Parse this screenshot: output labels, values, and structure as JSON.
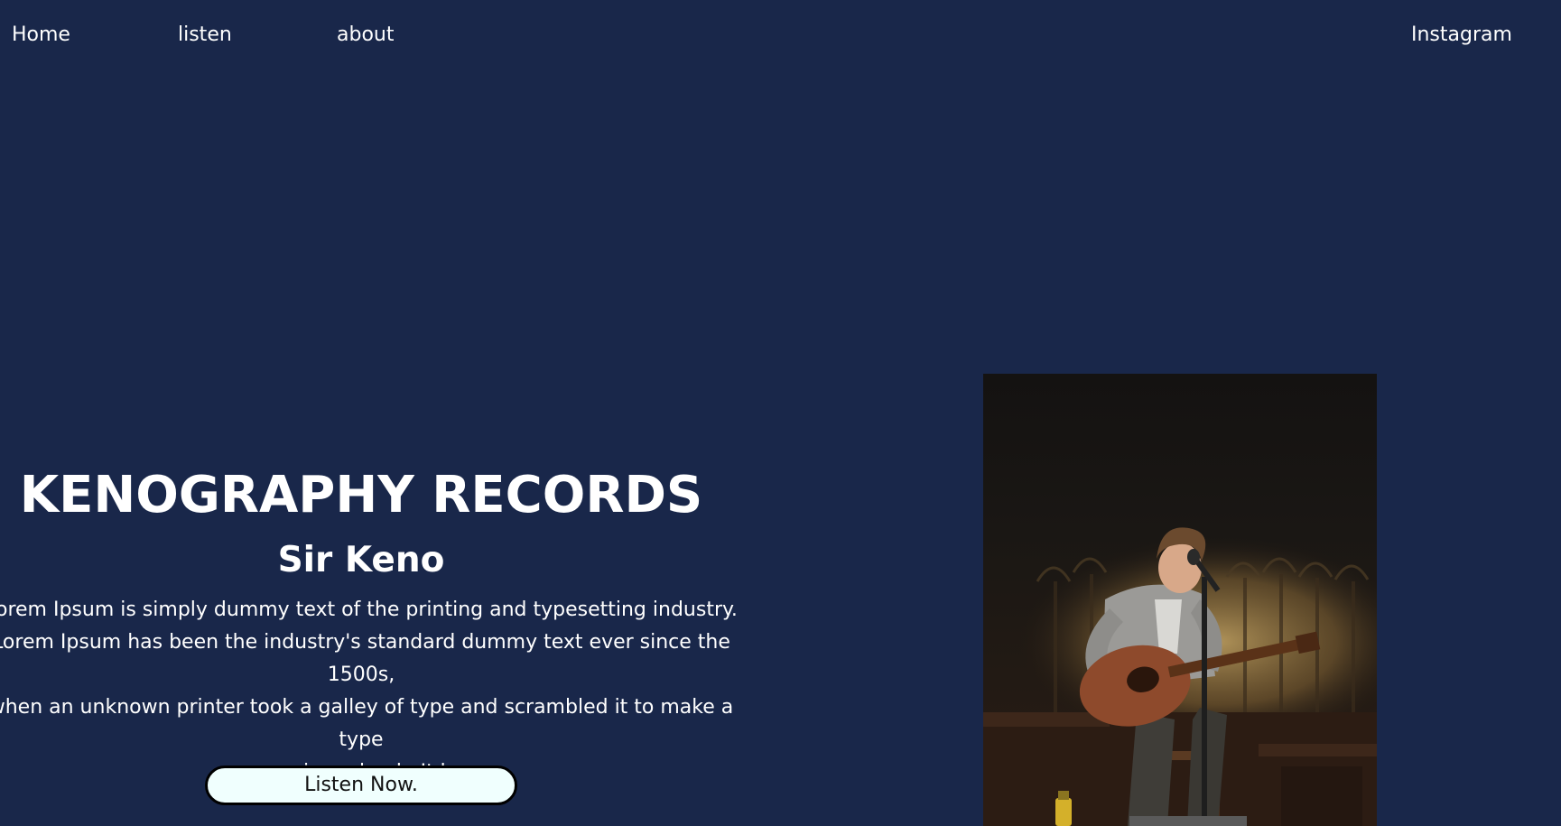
{
  "nav": {
    "home": "Home",
    "listen": "listen",
    "about": "about",
    "instagram": "Instagram"
  },
  "hero": {
    "title": "KENOGRAPHY RECORDS",
    "subtitle": "Sir Keno",
    "description": "Lorem Ipsum is simply dummy text of the printing and typesetting industry.\nLorem Ipsum has been the industry's standard dummy text ever since the 1500s,\nwhen an unknown printer took a galley of type and scrambled it to make a type\nspecimen book. It ha",
    "button_label": "Listen Now."
  },
  "colors": {
    "background": "#19274a",
    "text": "#ffffff",
    "button_bg": "#f0fffe",
    "button_border": "#000000"
  },
  "image": {
    "subject": "musician-playing-guitar-photo"
  }
}
